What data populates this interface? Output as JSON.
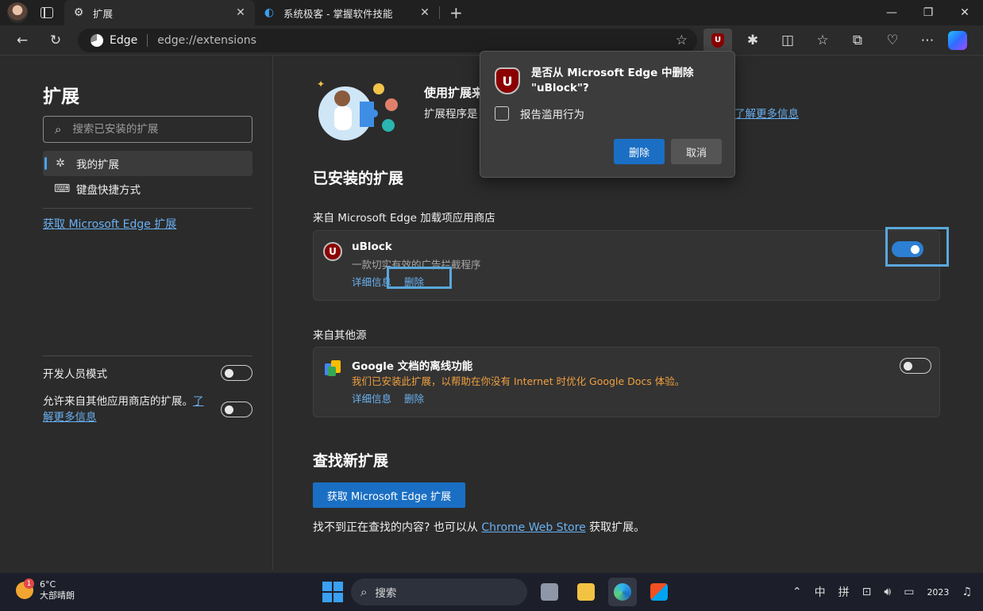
{
  "browser": {
    "tabs": [
      {
        "title": "扩展",
        "active": true
      },
      {
        "title": "系统极客 - 掌握软件技能",
        "active": false
      }
    ],
    "address": {
      "label": "Edge",
      "url": "edge://extensions"
    }
  },
  "sidebar": {
    "title": "扩展",
    "search_placeholder": "搜索已安装的扩展",
    "nav": [
      {
        "label": "我的扩展",
        "icon": "puzzle-icon",
        "active": true
      },
      {
        "label": "键盘快捷方式",
        "icon": "keyboard-icon",
        "active": false
      }
    ],
    "get_link": "获取 Microsoft Edge 扩展",
    "dev_mode_label": "开发人员模式",
    "dev_mode_on": false,
    "allow_label": "允许来自其他应用商店的扩展。",
    "allow_link": "了解更多信息",
    "allow_on": false
  },
  "main": {
    "hero_title": "使用扩展来",
    "hero_desc": "扩展程序是",
    "hero_more": "了解更多信息",
    "installed_heading": "已安装的扩展",
    "store_source": "来自 Microsoft Edge 加载项应用商店",
    "other_source": "来自其他源",
    "extensions": [
      {
        "name": "uBlock",
        "desc": "一款切实有效的广告拦截程序",
        "details": "详细信息",
        "remove": "删除",
        "enabled": true,
        "icon": "ublock-icon"
      },
      {
        "name": "Google 文档的离线功能",
        "desc": "我们已安装此扩展，以帮助在你没有 Internet 时优化 Google Docs 体验。",
        "details": "详细信息",
        "remove": "删除",
        "enabled": false,
        "icon": "google-docs-icon"
      }
    ],
    "find_heading": "查找新扩展",
    "get_button": "获取 Microsoft Edge 扩展",
    "bottom_text_pre": "找不到正在查找的内容? 也可以从",
    "bottom_link": "Chrome Web Store",
    "bottom_text_post": "获取扩展。"
  },
  "dialog": {
    "title_line1": "是否从 Microsoft Edge 中删除",
    "title_line2": "\"uBlock\"?",
    "checkbox_label": "报告滥用行为",
    "ok": "删除",
    "cancel": "取消"
  },
  "taskbar": {
    "weather_temp": "6°C",
    "weather_desc": "大部晴朗",
    "weather_badge": "1",
    "search": "搜索",
    "ime1": "中",
    "ime2": "拼",
    "clock": "2023"
  },
  "colors": {
    "accent": "#1a6fc4",
    "link": "#69b1f2",
    "highlight": "#5aa8dc",
    "ublock": "#8b0000"
  }
}
